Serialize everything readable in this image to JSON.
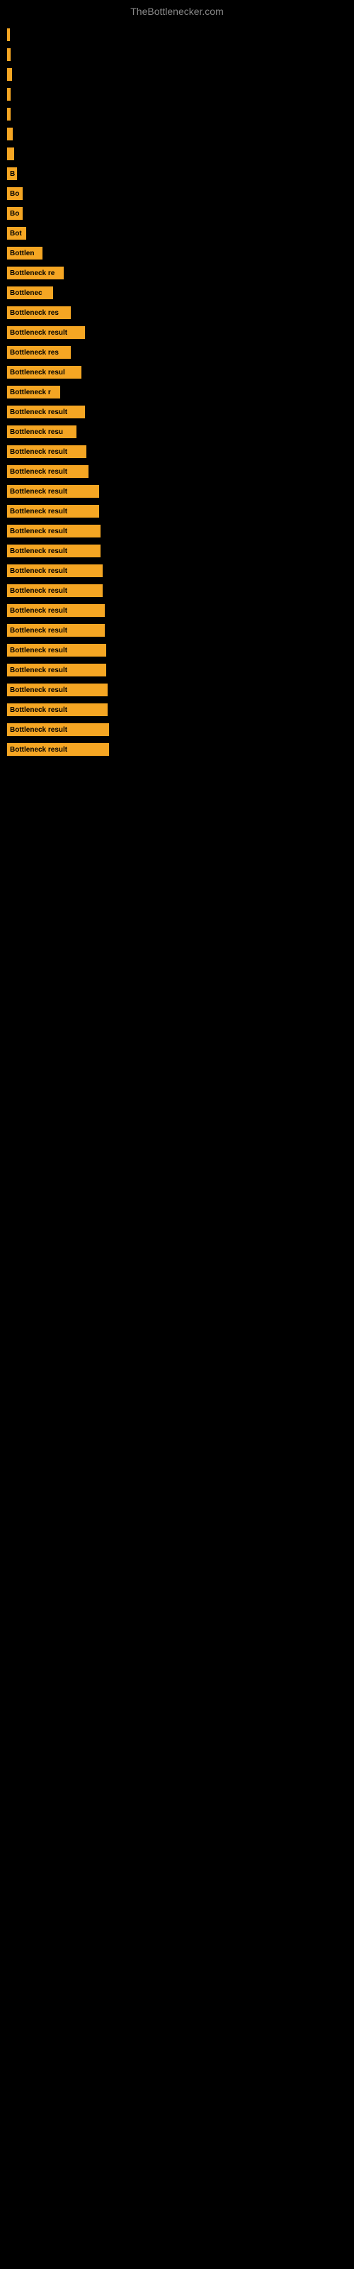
{
  "site": {
    "title": "TheBottlenecker.com"
  },
  "bars": [
    {
      "id": 1,
      "label": "",
      "width": 4
    },
    {
      "id": 2,
      "label": "",
      "width": 5
    },
    {
      "id": 3,
      "label": "",
      "width": 7
    },
    {
      "id": 4,
      "label": "",
      "width": 5
    },
    {
      "id": 5,
      "label": "",
      "width": 5
    },
    {
      "id": 6,
      "label": "",
      "width": 8
    },
    {
      "id": 7,
      "label": "",
      "width": 10
    },
    {
      "id": 8,
      "label": "B",
      "width": 14
    },
    {
      "id": 9,
      "label": "Bo",
      "width": 22
    },
    {
      "id": 10,
      "label": "Bo",
      "width": 22
    },
    {
      "id": 11,
      "label": "Bot",
      "width": 27
    },
    {
      "id": 12,
      "label": "Bottlen",
      "width": 50
    },
    {
      "id": 13,
      "label": "Bottleneck re",
      "width": 80
    },
    {
      "id": 14,
      "label": "Bottlenec",
      "width": 65
    },
    {
      "id": 15,
      "label": "Bottleneck res",
      "width": 90
    },
    {
      "id": 16,
      "label": "Bottleneck result",
      "width": 110
    },
    {
      "id": 17,
      "label": "Bottleneck res",
      "width": 90
    },
    {
      "id": 18,
      "label": "Bottleneck resul",
      "width": 105
    },
    {
      "id": 19,
      "label": "Bottleneck r",
      "width": 75
    },
    {
      "id": 20,
      "label": "Bottleneck result",
      "width": 110
    },
    {
      "id": 21,
      "label": "Bottleneck resu",
      "width": 98
    },
    {
      "id": 22,
      "label": "Bottleneck result",
      "width": 112
    },
    {
      "id": 23,
      "label": "Bottleneck result",
      "width": 115
    },
    {
      "id": 24,
      "label": "Bottleneck result",
      "width": 130
    },
    {
      "id": 25,
      "label": "Bottleneck result",
      "width": 130
    },
    {
      "id": 26,
      "label": "Bottleneck result",
      "width": 132
    },
    {
      "id": 27,
      "label": "Bottleneck result",
      "width": 132
    },
    {
      "id": 28,
      "label": "Bottleneck result",
      "width": 135
    },
    {
      "id": 29,
      "label": "Bottleneck result",
      "width": 135
    },
    {
      "id": 30,
      "label": "Bottleneck result",
      "width": 138
    },
    {
      "id": 31,
      "label": "Bottleneck result",
      "width": 138
    },
    {
      "id": 32,
      "label": "Bottleneck result",
      "width": 140
    },
    {
      "id": 33,
      "label": "Bottleneck result",
      "width": 140
    },
    {
      "id": 34,
      "label": "Bottleneck result",
      "width": 142
    },
    {
      "id": 35,
      "label": "Bottleneck result",
      "width": 142
    },
    {
      "id": 36,
      "label": "Bottleneck result",
      "width": 144
    },
    {
      "id": 37,
      "label": "Bottleneck result",
      "width": 144
    }
  ]
}
